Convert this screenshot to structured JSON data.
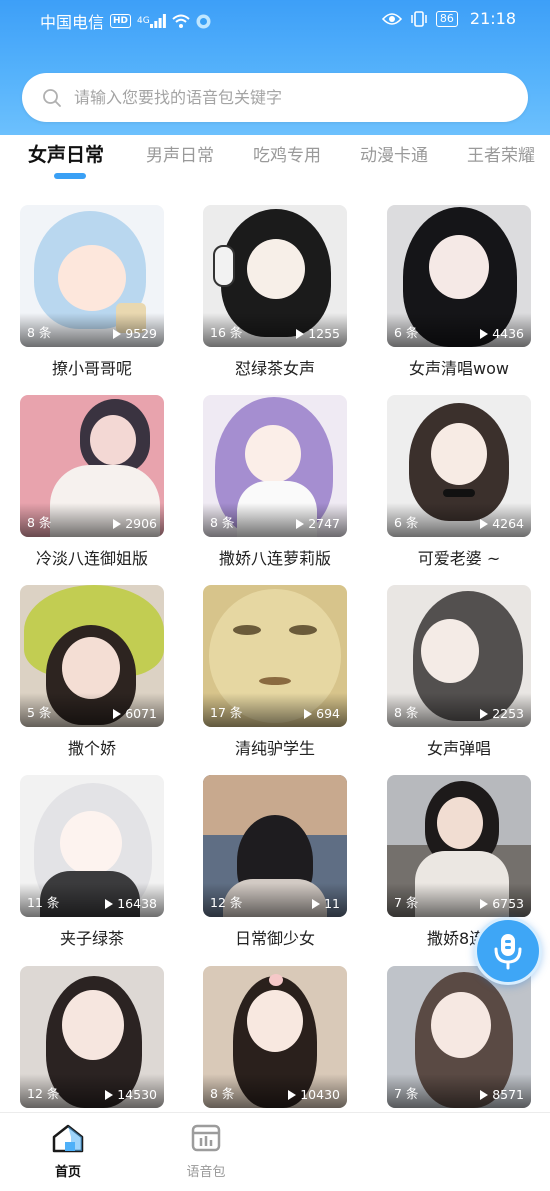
{
  "status_bar": {
    "carrier": "中国电信",
    "hd": "HD",
    "network": "4G",
    "battery": "86",
    "time": "21:18"
  },
  "search": {
    "placeholder": "请输入您要找的语音包关键字"
  },
  "tabs": [
    {
      "label": "女声日常",
      "active": true
    },
    {
      "label": "男声日常",
      "active": false
    },
    {
      "label": "吃鸡专用",
      "active": false
    },
    {
      "label": "动漫卡通",
      "active": false
    },
    {
      "label": "王者荣耀",
      "active": false
    }
  ],
  "cards": [
    {
      "title": "撩小哥哥呢",
      "count": "8 条",
      "plays": "9529"
    },
    {
      "title": "怼绿茶女声",
      "count": "16 条",
      "plays": "1255"
    },
    {
      "title": "女声清唱wow",
      "count": "6 条",
      "plays": "4436"
    },
    {
      "title": "冷淡八连御姐版",
      "count": "8 条",
      "plays": "2906"
    },
    {
      "title": "撒娇八连萝莉版",
      "count": "8 条",
      "plays": "2747"
    },
    {
      "title": "可爱老婆 ~",
      "count": "6 条",
      "plays": "4264"
    },
    {
      "title": "撒个娇",
      "count": "5 条",
      "plays": "6071"
    },
    {
      "title": "清纯驴学生",
      "count": "17 条",
      "plays": "694"
    },
    {
      "title": "女声弹唱",
      "count": "8 条",
      "plays": "2253"
    },
    {
      "title": "夹子绿茶",
      "count": "11 条",
      "plays": "16438"
    },
    {
      "title": "日常御少女",
      "count": "12 条",
      "plays": "11"
    },
    {
      "title": "撒娇8连-",
      "count": "7 条",
      "plays": "6753"
    },
    {
      "title": "",
      "count": "12 条",
      "plays": "14530"
    },
    {
      "title": "",
      "count": "8 条",
      "plays": "10430"
    },
    {
      "title": "",
      "count": "7 条",
      "plays": "8571"
    }
  ],
  "bottom_nav": [
    {
      "label": "首页",
      "icon": "home-icon",
      "active": true
    },
    {
      "label": "语音包",
      "icon": "voice-pack-icon",
      "active": false
    }
  ],
  "colors": {
    "header": "#4aa9f9",
    "accent": "#3aa0f5",
    "fab": "#3ea6f6"
  }
}
